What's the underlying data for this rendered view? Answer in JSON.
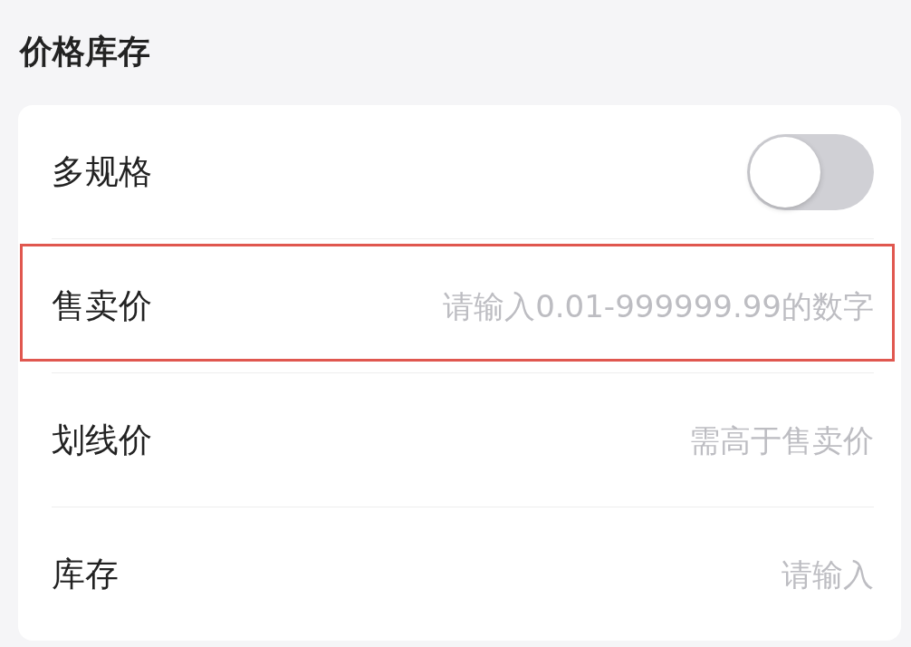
{
  "section_title": "价格库存",
  "rows": [
    {
      "kind": "toggle",
      "label": "多规格",
      "on": false
    },
    {
      "kind": "input",
      "label": "售卖价",
      "placeholder": "请输入0.01-999999.99的数字",
      "highlighted": true
    },
    {
      "kind": "input",
      "label": "划线价",
      "placeholder": "需高于售卖价",
      "highlighted": false
    },
    {
      "kind": "input",
      "label": "库存",
      "placeholder": "请输入",
      "highlighted": false
    }
  ]
}
